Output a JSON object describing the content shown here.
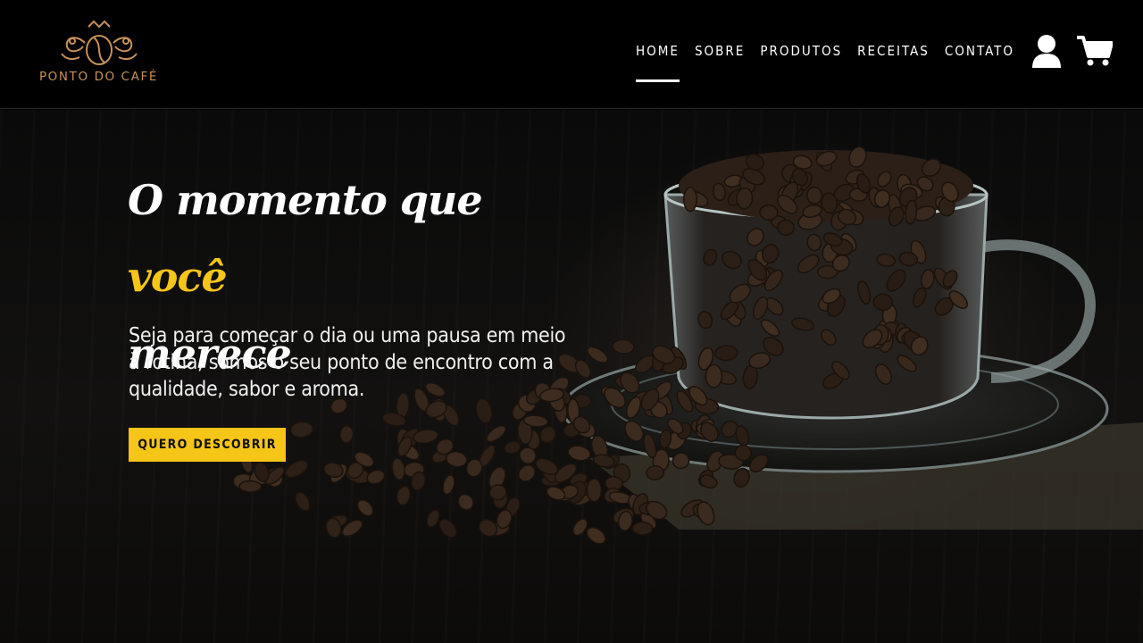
{
  "brand": {
    "name": "PONTO DO CAFÉ",
    "logo_icon": "coffee-bean-crest-icon",
    "color": "#c8915a"
  },
  "nav": {
    "items": [
      {
        "label": "HOME",
        "active": true
      },
      {
        "label": "SOBRE"
      },
      {
        "label": "PRODUTOS"
      },
      {
        "label": "RECEITAS"
      },
      {
        "label": "CONTATO"
      }
    ],
    "account_icon": "user-icon",
    "cart_icon": "cart-icon"
  },
  "hero": {
    "headline_part1": "O momento que ",
    "headline_highlight": "você",
    "headline_part2": "merece",
    "highlight_color": "#f5c518",
    "subtext": "Seja para começar o dia ou uma pausa em meio à rotina, somos o seu ponto de encontro com a qualidade, sabor e aroma.",
    "cta_label": "QUERO DESCOBRIR",
    "image": "glass-cup-of-coffee-beans"
  }
}
